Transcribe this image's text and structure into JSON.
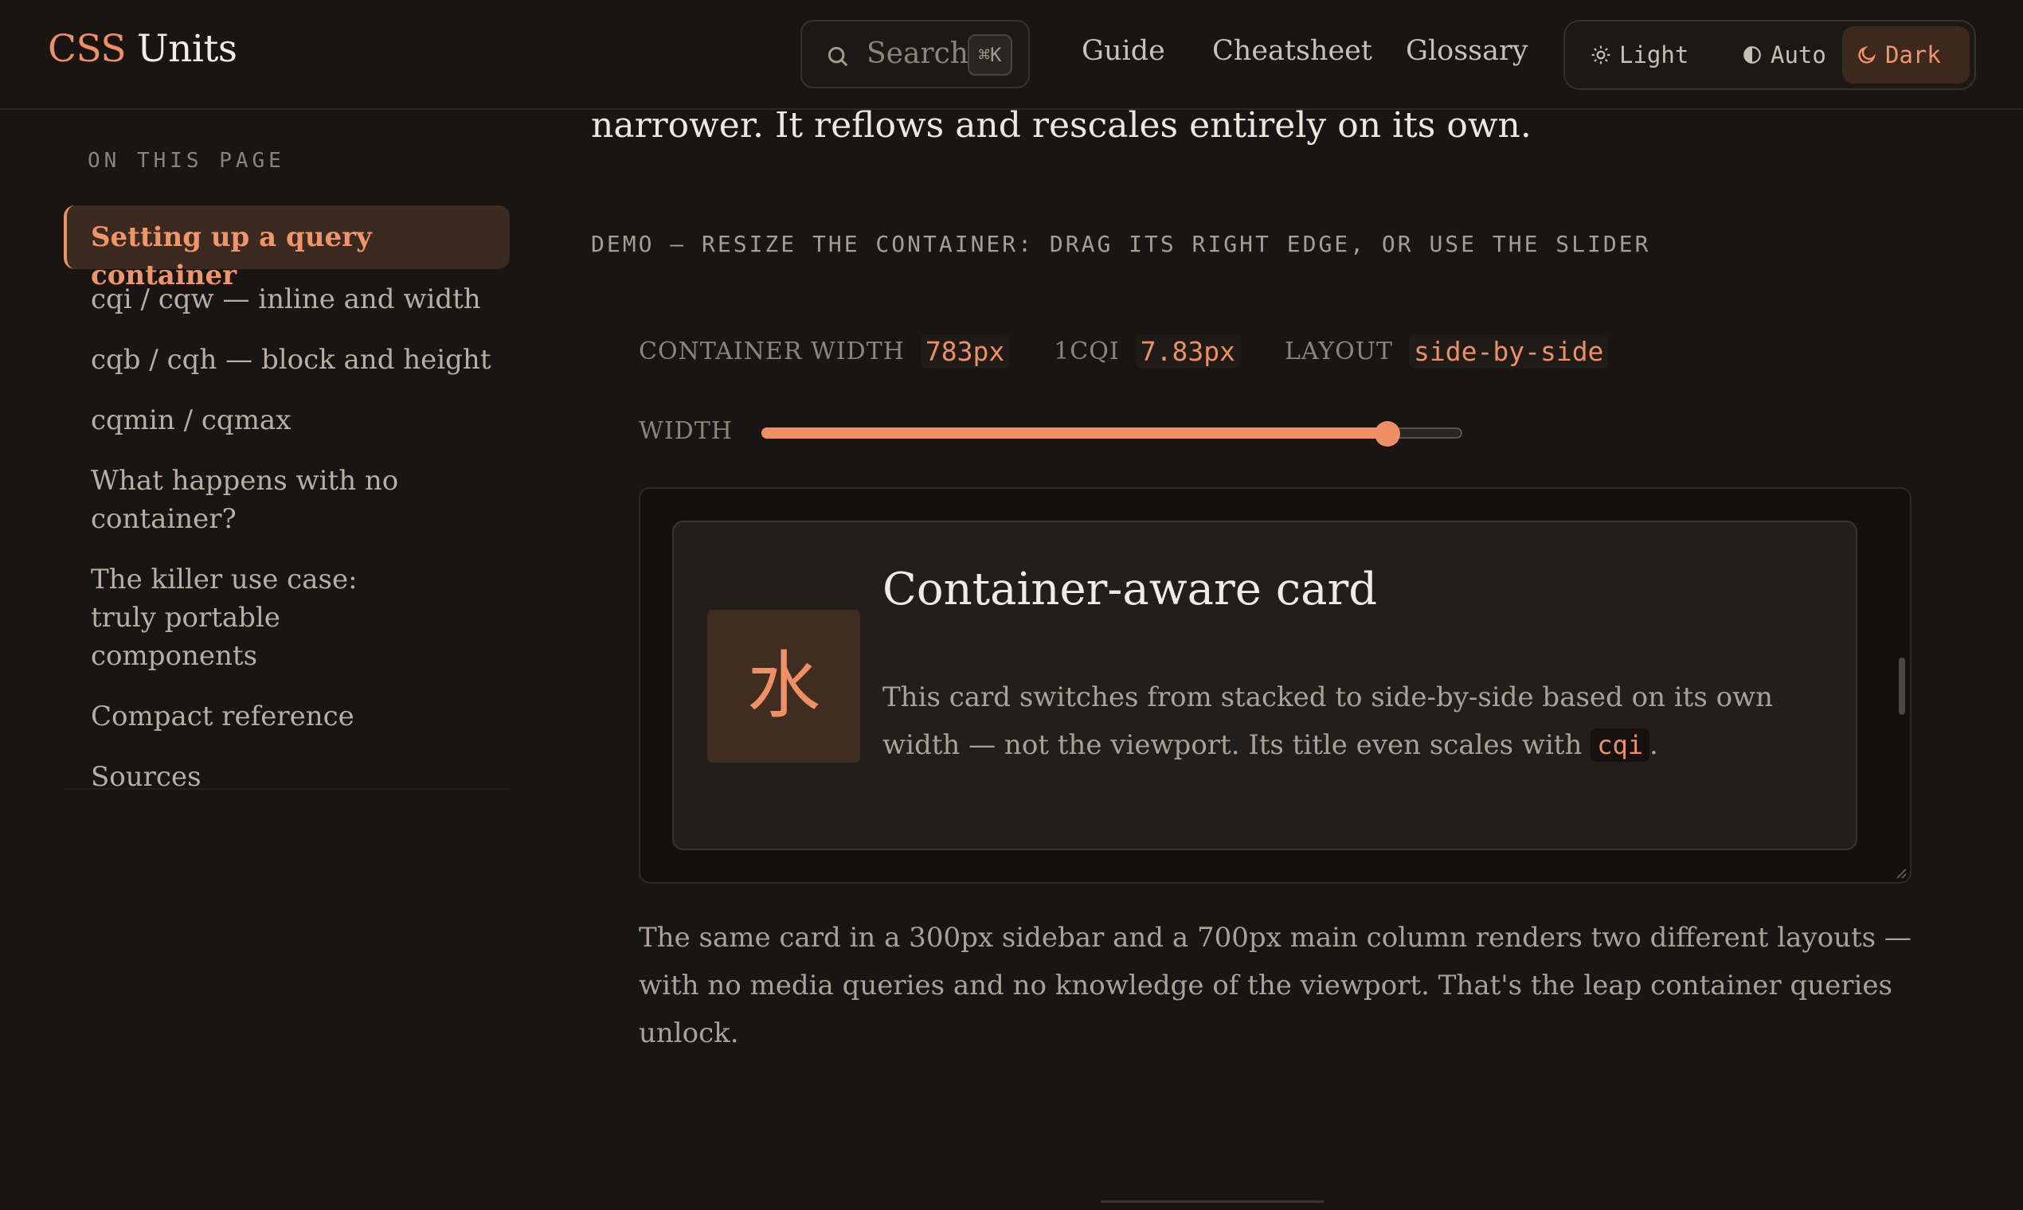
{
  "header": {
    "logo_part1": "CSS",
    "logo_part2": "Units",
    "search": {
      "placeholder": "Search",
      "shortcut": "⌘K",
      "icon": "search-icon"
    },
    "nav": [
      "Guide",
      "Cheatsheet",
      "Glossary"
    ],
    "theme": {
      "options": [
        {
          "label": "Light",
          "icon": "sun-icon"
        },
        {
          "label": "Auto",
          "icon": "half-circle-icon"
        },
        {
          "label": "Dark",
          "icon": "moon-icon"
        }
      ],
      "selected": "Dark"
    }
  },
  "sidebar": {
    "title": "ON THIS PAGE",
    "items": [
      "Setting up a query container",
      "cqi / cqw — inline and width",
      "cqb / cqh — block and height",
      "cqmin / cqmax",
      "What happens with no container?",
      "The killer use case: truly portable components",
      "Compact reference",
      "Sources"
    ],
    "active_index": 0
  },
  "main": {
    "intro": "narrower. It reflows and rescales entirely on its own.",
    "demo_label": "DEMO — RESIZE THE CONTAINER: DRAG ITS RIGHT EDGE, OR USE THE SLIDER",
    "stats": {
      "width_label": "CONTAINER WIDTH",
      "width_value": "783px",
      "cqi_label": "1CQI",
      "cqi_value": "7.83px",
      "layout_label": "LAYOUT",
      "layout_value": "side-by-side"
    },
    "slider": {
      "label": "WIDTH",
      "fraction": 0.893
    },
    "card": {
      "icon_glyph": "水",
      "title": "Container-aware card",
      "body": "This card switches from stacked to side-by-side based on its own width — not the viewport. Its title even scales with",
      "code": "cqi",
      "body_end": "."
    },
    "outro": "The same card in a 300px sidebar and a 700px main column renders two different layouts — with no media queries and no knowledge of the viewport. That's the leap container queries unlock."
  },
  "colors": {
    "accent": "#ef8f63",
    "background": "#181512",
    "active_bg": "#3a2a20"
  }
}
